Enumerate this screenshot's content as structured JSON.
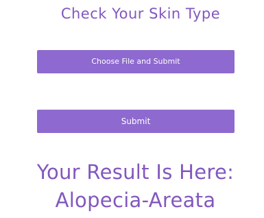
{
  "header": {
    "title": "Check Your Skin Type"
  },
  "form": {
    "upload_button_label": "Choose File and Submit",
    "submit_button_label": "Submit"
  },
  "result": {
    "heading": "Your Result Is Here:",
    "value": "Alopecia-Areata"
  },
  "colors": {
    "accent_text": "#8257bf",
    "button_background": "#8e69cf",
    "button_text": "#ffffff",
    "page_background": "#ffffff"
  }
}
